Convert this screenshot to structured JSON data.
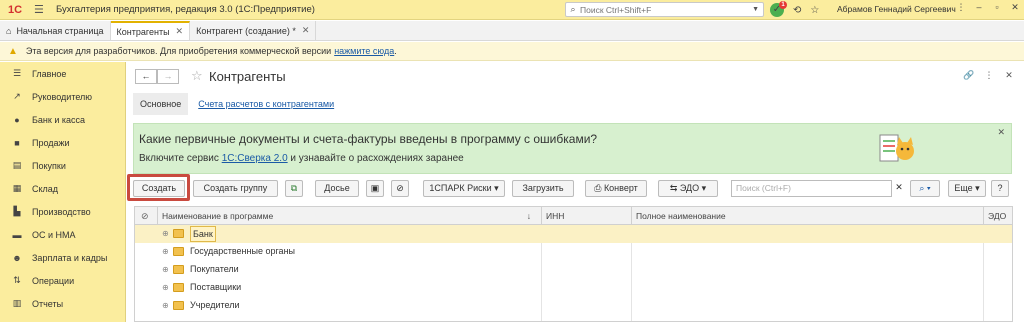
{
  "app": {
    "logo": "1С",
    "title": "Бухгалтерия предприятия, редакция 3.0  (1С:Предприятие)",
    "search_placeholder": "Поиск Ctrl+Shift+F",
    "notification_count": "1",
    "user": "Абрамов Геннадий Сергеевич"
  },
  "tabs": [
    {
      "label": "Начальная страница",
      "closable": false
    },
    {
      "label": "Контрагенты",
      "closable": true,
      "active": true
    },
    {
      "label": "Контрагент (создание) *",
      "closable": true
    }
  ],
  "warning": {
    "text": "Эта версия для разработчиков. Для приобретения коммерческой версии",
    "link": "нажмите сюда",
    "tail": "."
  },
  "sidebar": {
    "items": [
      {
        "label": "Главное",
        "icon": "menu-icon"
      },
      {
        "label": "Руководителю",
        "icon": "trend-icon"
      },
      {
        "label": "Банк и касса",
        "icon": "coin-icon"
      },
      {
        "label": "Продажи",
        "icon": "bag-icon"
      },
      {
        "label": "Покупки",
        "icon": "cart-icon"
      },
      {
        "label": "Склад",
        "icon": "warehouse-icon"
      },
      {
        "label": "Производство",
        "icon": "factory-icon"
      },
      {
        "label": "ОС и НМА",
        "icon": "car-icon"
      },
      {
        "label": "Зарплата и кадры",
        "icon": "people-icon"
      },
      {
        "label": "Операции",
        "icon": "dt-kt-icon"
      },
      {
        "label": "Отчеты",
        "icon": "chart-icon"
      }
    ]
  },
  "page": {
    "title": "Контрагенты",
    "subtab_main": "Основное",
    "subtab_link": "Счета расчетов с контрагентами"
  },
  "banner": {
    "headline": "Какие первичные документы и счета-фактуры введены в программу с ошибками?",
    "sub_before": "Включите сервис ",
    "sub_link": "1С:Сверка 2.0",
    "sub_after": " и узнавайте о расхождениях заранее"
  },
  "toolbar": {
    "create": "Создать",
    "create_group": "Создать группу",
    "dossier": "Досье",
    "spark": "1СПАРК Риски",
    "load": "Загрузить",
    "envelope": "Конверт",
    "edo": "ЭДО",
    "search_placeholder": "Поиск (Ctrl+F)",
    "more": "Еще",
    "help": "?"
  },
  "table": {
    "columns": [
      "Наименование в программе",
      "ИНН",
      "Полное наименование",
      "ЭДО"
    ],
    "rows": [
      {
        "name": "Банк",
        "selected": true
      },
      {
        "name": "Государственные органы"
      },
      {
        "name": "Покупатели"
      },
      {
        "name": "Поставщики"
      },
      {
        "name": "Учредители"
      }
    ]
  },
  "colors": {
    "topbar": "#fbed9e",
    "banner": "#d7f0cf",
    "link": "#1a5aa6",
    "highlight": "#c94a3f"
  }
}
